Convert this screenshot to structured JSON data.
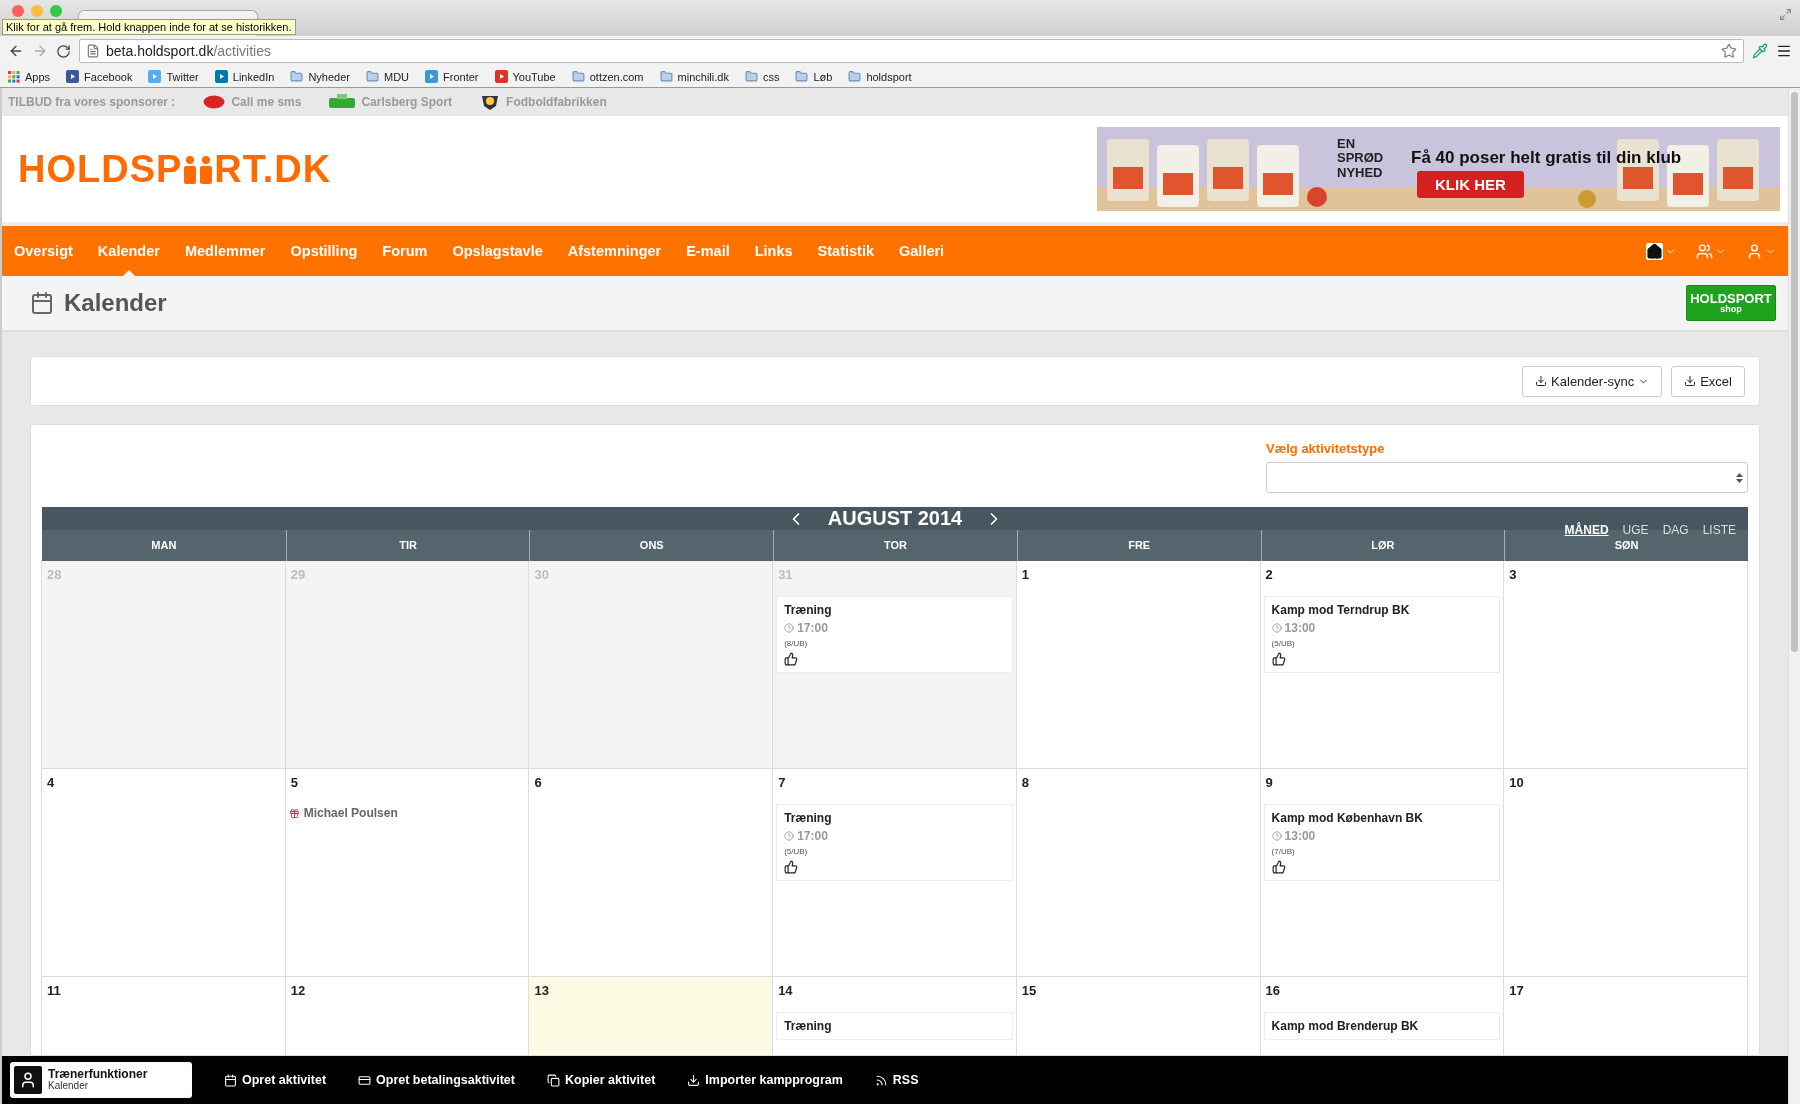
{
  "browser": {
    "tooltip": "Klik for at gå frem. Hold knappen inde for at se historikken.",
    "url_host": "beta.holdsport.dk",
    "url_path": "/activities",
    "bookmarks": [
      {
        "label": "Apps",
        "kind": "apps"
      },
      {
        "label": "Facebook",
        "kind": "facebook"
      },
      {
        "label": "Twitter",
        "kind": "twitter"
      },
      {
        "label": "LinkedIn",
        "kind": "linkedin"
      },
      {
        "label": "Nyheder",
        "kind": "folder"
      },
      {
        "label": "MDU",
        "kind": "folder"
      },
      {
        "label": "Fronter",
        "kind": "fronter"
      },
      {
        "label": "YouTube",
        "kind": "youtube"
      },
      {
        "label": "ottzen.com",
        "kind": "folder"
      },
      {
        "label": "minchili.dk",
        "kind": "folder"
      },
      {
        "label": "css",
        "kind": "folder"
      },
      {
        "label": "Løb",
        "kind": "folder"
      },
      {
        "label": "holdsport",
        "kind": "folder"
      }
    ]
  },
  "sponsor_bar": {
    "label": "TILBUD fra vores sponsorer :",
    "sponsors": [
      {
        "name": "Call me sms",
        "kind": "callme"
      },
      {
        "name": "Carlsberg Sport",
        "kind": "carlsberg"
      },
      {
        "name": "Fodboldfabrikken",
        "kind": "ball"
      }
    ]
  },
  "logo": {
    "before": "HOLDSP",
    "after": "RT.DK"
  },
  "ad": {
    "tagline": "EN SPRØD NYHED",
    "headline": "Få 40 poser helt gratis til din klub",
    "button": "KLIK HER"
  },
  "nav": {
    "items": [
      {
        "label": "Oversigt",
        "selected": false
      },
      {
        "label": "Kalender",
        "selected": true
      },
      {
        "label": "Medlemmer",
        "selected": false
      },
      {
        "label": "Opstilling",
        "selected": false
      },
      {
        "label": "Forum",
        "selected": false
      },
      {
        "label": "Opslagstavle",
        "selected": false
      },
      {
        "label": "Afstemninger",
        "selected": false
      },
      {
        "label": "E-mail",
        "selected": false
      },
      {
        "label": "Links",
        "selected": false
      },
      {
        "label": "Statistik",
        "selected": false
      },
      {
        "label": "Galleri",
        "selected": false
      }
    ],
    "menus": [
      {
        "kind": "home"
      },
      {
        "kind": "team"
      },
      {
        "kind": "user"
      }
    ]
  },
  "page_title": "Kalender",
  "shop_button": {
    "title": "HOLDSPORT",
    "subtitle": "shop"
  },
  "toolbar": [
    {
      "label": "Kalender-sync",
      "dropdown": true
    },
    {
      "label": "Excel",
      "dropdown": false
    }
  ],
  "filter": {
    "label": "Vælg aktivitetstype"
  },
  "calendar": {
    "title": "AUGUST 2014",
    "views": [
      {
        "label": "MÅNED",
        "selected": true
      },
      {
        "label": "UGE",
        "selected": false
      },
      {
        "label": "DAG",
        "selected": false
      },
      {
        "label": "LISTE",
        "selected": false
      }
    ],
    "weekdays": [
      "MAN",
      "TIR",
      "ONS",
      "TOR",
      "FRE",
      "LØR",
      "SØN"
    ],
    "weeks": [
      {
        "days": [
          {
            "day": "28",
            "kind": "other"
          },
          {
            "day": "29",
            "kind": "other"
          },
          {
            "day": "30",
            "kind": "other"
          },
          {
            "day": "31",
            "kind": "other",
            "events": [
              {
                "kind": "activity",
                "title": "Træning",
                "time": "17:00",
                "count": "(8/UB)"
              }
            ]
          },
          {
            "day": "1",
            "kind": "current"
          },
          {
            "day": "2",
            "kind": "current",
            "events": [
              {
                "kind": "activity",
                "title": "Kamp mod Terndrup BK",
                "time": "13:00",
                "count": "(5/UB)"
              }
            ]
          },
          {
            "day": "3",
            "kind": "current"
          }
        ]
      },
      {
        "days": [
          {
            "day": "4",
            "kind": "current"
          },
          {
            "day": "5",
            "kind": "current",
            "events": [
              {
                "kind": "birthday",
                "title": "Michael Poulsen"
              }
            ]
          },
          {
            "day": "6",
            "kind": "current"
          },
          {
            "day": "7",
            "kind": "current",
            "events": [
              {
                "kind": "activity",
                "title": "Træning",
                "time": "17:00",
                "count": "(5/UB)"
              }
            ]
          },
          {
            "day": "8",
            "kind": "current"
          },
          {
            "day": "9",
            "kind": "current",
            "events": [
              {
                "kind": "activity",
                "title": "Kamp mod København BK",
                "time": "13:00",
                "count": "(7/UB)"
              }
            ]
          },
          {
            "day": "10",
            "kind": "current"
          }
        ]
      },
      {
        "days": [
          {
            "day": "11",
            "kind": "current"
          },
          {
            "day": "12",
            "kind": "current"
          },
          {
            "day": "13",
            "kind": "today"
          },
          {
            "day": "14",
            "kind": "current",
            "events": [
              {
                "kind": "activity",
                "title": "Træning"
              }
            ]
          },
          {
            "day": "15",
            "kind": "current"
          },
          {
            "day": "16",
            "kind": "current",
            "events": [
              {
                "kind": "activity",
                "title": "Kamp mod Brenderup BK"
              }
            ]
          },
          {
            "day": "17",
            "kind": "current"
          }
        ]
      }
    ]
  },
  "bottom_bar": {
    "title": "Trænerfunktioner",
    "subtitle": "Kalender",
    "actions": [
      {
        "label": "Opret aktivitet",
        "kind": "calendar"
      },
      {
        "label": "Opret betalingsaktivitet",
        "kind": "card"
      },
      {
        "label": "Kopier aktivitet",
        "kind": "copy"
      },
      {
        "label": "Importer kampprogram",
        "kind": "download"
      },
      {
        "label": "RSS",
        "kind": "rss"
      }
    ]
  }
}
